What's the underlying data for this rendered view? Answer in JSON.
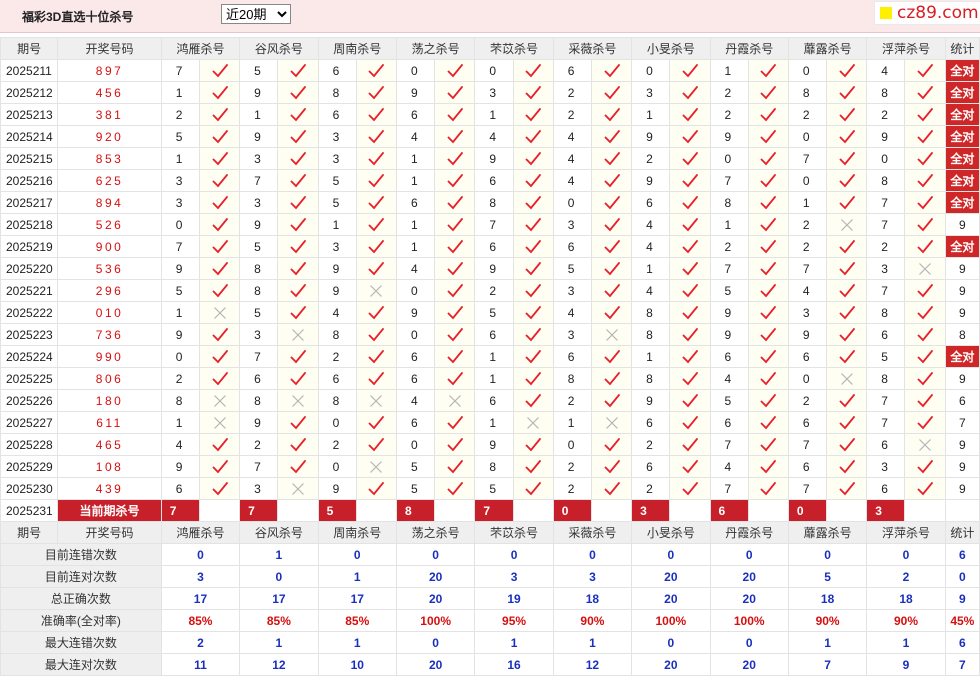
{
  "header": {
    "title": "福彩3D直选十位杀号",
    "select_value": "近20期",
    "logo_text": "cz89.com"
  },
  "columns": {
    "issue": "期号",
    "number": "开奖号码",
    "stat": "统计",
    "experts": [
      "鸿雁杀号",
      "谷风杀号",
      "周南杀号",
      "荡之杀号",
      "芣苡杀号",
      "采薇杀号",
      "小旻杀号",
      "丹霞杀号",
      "蘼露杀号",
      "浮萍杀号"
    ]
  },
  "rows": [
    {
      "issue": "2025211",
      "num": "897",
      "kills": [
        "7",
        "5",
        "6",
        "0",
        "0",
        "6",
        "0",
        "1",
        "0",
        "4"
      ],
      "ok": [
        1,
        1,
        1,
        1,
        1,
        1,
        1,
        1,
        1,
        1
      ],
      "stat": "全对"
    },
    {
      "issue": "2025212",
      "num": "456",
      "kills": [
        "1",
        "9",
        "8",
        "9",
        "3",
        "2",
        "3",
        "2",
        "8",
        "8"
      ],
      "ok": [
        1,
        1,
        1,
        1,
        1,
        1,
        1,
        1,
        1,
        1
      ],
      "stat": "全对"
    },
    {
      "issue": "2025213",
      "num": "381",
      "kills": [
        "2",
        "1",
        "6",
        "6",
        "1",
        "2",
        "1",
        "2",
        "2",
        "2"
      ],
      "ok": [
        1,
        1,
        1,
        1,
        1,
        1,
        1,
        1,
        1,
        1
      ],
      "stat": "全对"
    },
    {
      "issue": "2025214",
      "num": "920",
      "kills": [
        "5",
        "9",
        "3",
        "4",
        "4",
        "4",
        "9",
        "9",
        "0",
        "9"
      ],
      "ok": [
        1,
        1,
        1,
        1,
        1,
        1,
        1,
        1,
        1,
        1
      ],
      "stat": "全对"
    },
    {
      "issue": "2025215",
      "num": "853",
      "kills": [
        "1",
        "3",
        "3",
        "1",
        "9",
        "4",
        "2",
        "0",
        "7",
        "0"
      ],
      "ok": [
        1,
        1,
        1,
        1,
        1,
        1,
        1,
        1,
        1,
        1
      ],
      "stat": "全对"
    },
    {
      "issue": "2025216",
      "num": "625",
      "kills": [
        "3",
        "7",
        "5",
        "1",
        "6",
        "4",
        "9",
        "7",
        "0",
        "8"
      ],
      "ok": [
        1,
        1,
        1,
        1,
        1,
        1,
        1,
        1,
        1,
        1
      ],
      "stat": "全对"
    },
    {
      "issue": "2025217",
      "num": "894",
      "kills": [
        "3",
        "3",
        "5",
        "6",
        "8",
        "0",
        "6",
        "8",
        "1",
        "7"
      ],
      "ok": [
        1,
        1,
        1,
        1,
        1,
        1,
        1,
        1,
        1,
        1
      ],
      "stat": "全对"
    },
    {
      "issue": "2025218",
      "num": "526",
      "kills": [
        "0",
        "9",
        "1",
        "1",
        "7",
        "3",
        "4",
        "1",
        "2",
        "7"
      ],
      "ok": [
        1,
        1,
        1,
        1,
        1,
        1,
        1,
        1,
        0,
        1
      ],
      "stat": "9"
    },
    {
      "issue": "2025219",
      "num": "900",
      "kills": [
        "7",
        "5",
        "3",
        "1",
        "6",
        "6",
        "4",
        "2",
        "2",
        "2"
      ],
      "ok": [
        1,
        1,
        1,
        1,
        1,
        1,
        1,
        1,
        1,
        1
      ],
      "stat": "全对"
    },
    {
      "issue": "2025220",
      "num": "536",
      "kills": [
        "9",
        "8",
        "9",
        "4",
        "9",
        "5",
        "1",
        "7",
        "7",
        "3"
      ],
      "ok": [
        1,
        1,
        1,
        1,
        1,
        1,
        1,
        1,
        1,
        0
      ],
      "stat": "9"
    },
    {
      "issue": "2025221",
      "num": "296",
      "kills": [
        "5",
        "8",
        "9",
        "0",
        "2",
        "3",
        "4",
        "5",
        "4",
        "7"
      ],
      "ok": [
        1,
        1,
        0,
        1,
        1,
        1,
        1,
        1,
        1,
        1
      ],
      "stat": "9"
    },
    {
      "issue": "2025222",
      "num": "010",
      "kills": [
        "1",
        "5",
        "4",
        "9",
        "5",
        "4",
        "8",
        "9",
        "3",
        "8"
      ],
      "ok": [
        0,
        1,
        1,
        1,
        1,
        1,
        1,
        1,
        1,
        1
      ],
      "stat": "9"
    },
    {
      "issue": "2025223",
      "num": "736",
      "kills": [
        "9",
        "3",
        "8",
        "0",
        "6",
        "3",
        "8",
        "9",
        "9",
        "6"
      ],
      "ok": [
        1,
        0,
        1,
        1,
        1,
        0,
        1,
        1,
        1,
        1
      ],
      "stat": "8"
    },
    {
      "issue": "2025224",
      "num": "990",
      "kills": [
        "0",
        "7",
        "2",
        "6",
        "1",
        "6",
        "1",
        "6",
        "6",
        "5"
      ],
      "ok": [
        1,
        1,
        1,
        1,
        1,
        1,
        1,
        1,
        1,
        1
      ],
      "stat": "全对"
    },
    {
      "issue": "2025225",
      "num": "806",
      "kills": [
        "2",
        "6",
        "6",
        "6",
        "1",
        "8",
        "8",
        "4",
        "0",
        "8"
      ],
      "ok": [
        1,
        1,
        1,
        1,
        1,
        1,
        1,
        1,
        0,
        1
      ],
      "stat": "9"
    },
    {
      "issue": "2025226",
      "num": "180",
      "kills": [
        "8",
        "8",
        "8",
        "4",
        "6",
        "2",
        "9",
        "5",
        "2",
        "7"
      ],
      "ok": [
        0,
        0,
        0,
        0,
        1,
        1,
        1,
        1,
        1,
        1
      ],
      "stat": "6"
    },
    {
      "issue": "2025227",
      "num": "611",
      "kills": [
        "1",
        "9",
        "0",
        "6",
        "1",
        "1",
        "6",
        "6",
        "6",
        "7"
      ],
      "ok": [
        0,
        1,
        1,
        1,
        0,
        0,
        1,
        1,
        1,
        1
      ],
      "stat": "7"
    },
    {
      "issue": "2025228",
      "num": "465",
      "kills": [
        "4",
        "2",
        "2",
        "0",
        "9",
        "0",
        "2",
        "7",
        "7",
        "6"
      ],
      "ok": [
        1,
        1,
        1,
        1,
        1,
        1,
        1,
        1,
        1,
        0
      ],
      "stat": "9"
    },
    {
      "issue": "2025229",
      "num": "108",
      "kills": [
        "9",
        "7",
        "0",
        "5",
        "8",
        "2",
        "6",
        "4",
        "6",
        "3"
      ],
      "ok": [
        1,
        1,
        0,
        1,
        1,
        1,
        1,
        1,
        1,
        1
      ],
      "stat": "9"
    },
    {
      "issue": "2025230",
      "num": "439",
      "kills": [
        "6",
        "3",
        "9",
        "5",
        "5",
        "2",
        "2",
        "7",
        "7",
        "6"
      ],
      "ok": [
        1,
        0,
        1,
        1,
        1,
        1,
        1,
        1,
        1,
        1
      ],
      "stat": "9"
    }
  ],
  "current": {
    "issue": "2025231",
    "label": "当前期杀号",
    "kills": [
      "7",
      "7",
      "5",
      "8",
      "7",
      "0",
      "3",
      "6",
      "0",
      "3"
    ]
  },
  "stats": [
    {
      "label": "目前连错次数",
      "values": [
        "0",
        "1",
        "0",
        "0",
        "0",
        "0",
        "0",
        "0",
        "0",
        "0"
      ],
      "stat": "6",
      "red": false
    },
    {
      "label": "目前连对次数",
      "values": [
        "3",
        "0",
        "1",
        "20",
        "3",
        "3",
        "20",
        "20",
        "5",
        "2"
      ],
      "stat": "0",
      "red": false
    },
    {
      "label": "总正确次数",
      "values": [
        "17",
        "17",
        "17",
        "20",
        "19",
        "18",
        "20",
        "20",
        "18",
        "18"
      ],
      "stat": "9",
      "red": false
    },
    {
      "label": "准确率(全对率)",
      "values": [
        "85%",
        "85%",
        "85%",
        "100%",
        "95%",
        "90%",
        "100%",
        "100%",
        "90%",
        "90%"
      ],
      "stat": "45%",
      "red": true
    },
    {
      "label": "最大连错次数",
      "values": [
        "2",
        "1",
        "1",
        "0",
        "1",
        "1",
        "0",
        "0",
        "1",
        "1"
      ],
      "stat": "6",
      "red": false
    },
    {
      "label": "最大连对次数",
      "values": [
        "11",
        "12",
        "10",
        "20",
        "16",
        "12",
        "20",
        "20",
        "7",
        "9"
      ],
      "stat": "7",
      "red": false
    }
  ],
  "colors": {
    "tick": "#e8202a",
    "cross": "#b5b5b5",
    "full_bg": "#cf2727",
    "current_bg": "#c8202a",
    "stat_blue": "#1a2fbf",
    "stat_red": "#d60f0f"
  },
  "icons": {
    "correct": "checkmark-icon",
    "wrong": "cross-icon"
  }
}
